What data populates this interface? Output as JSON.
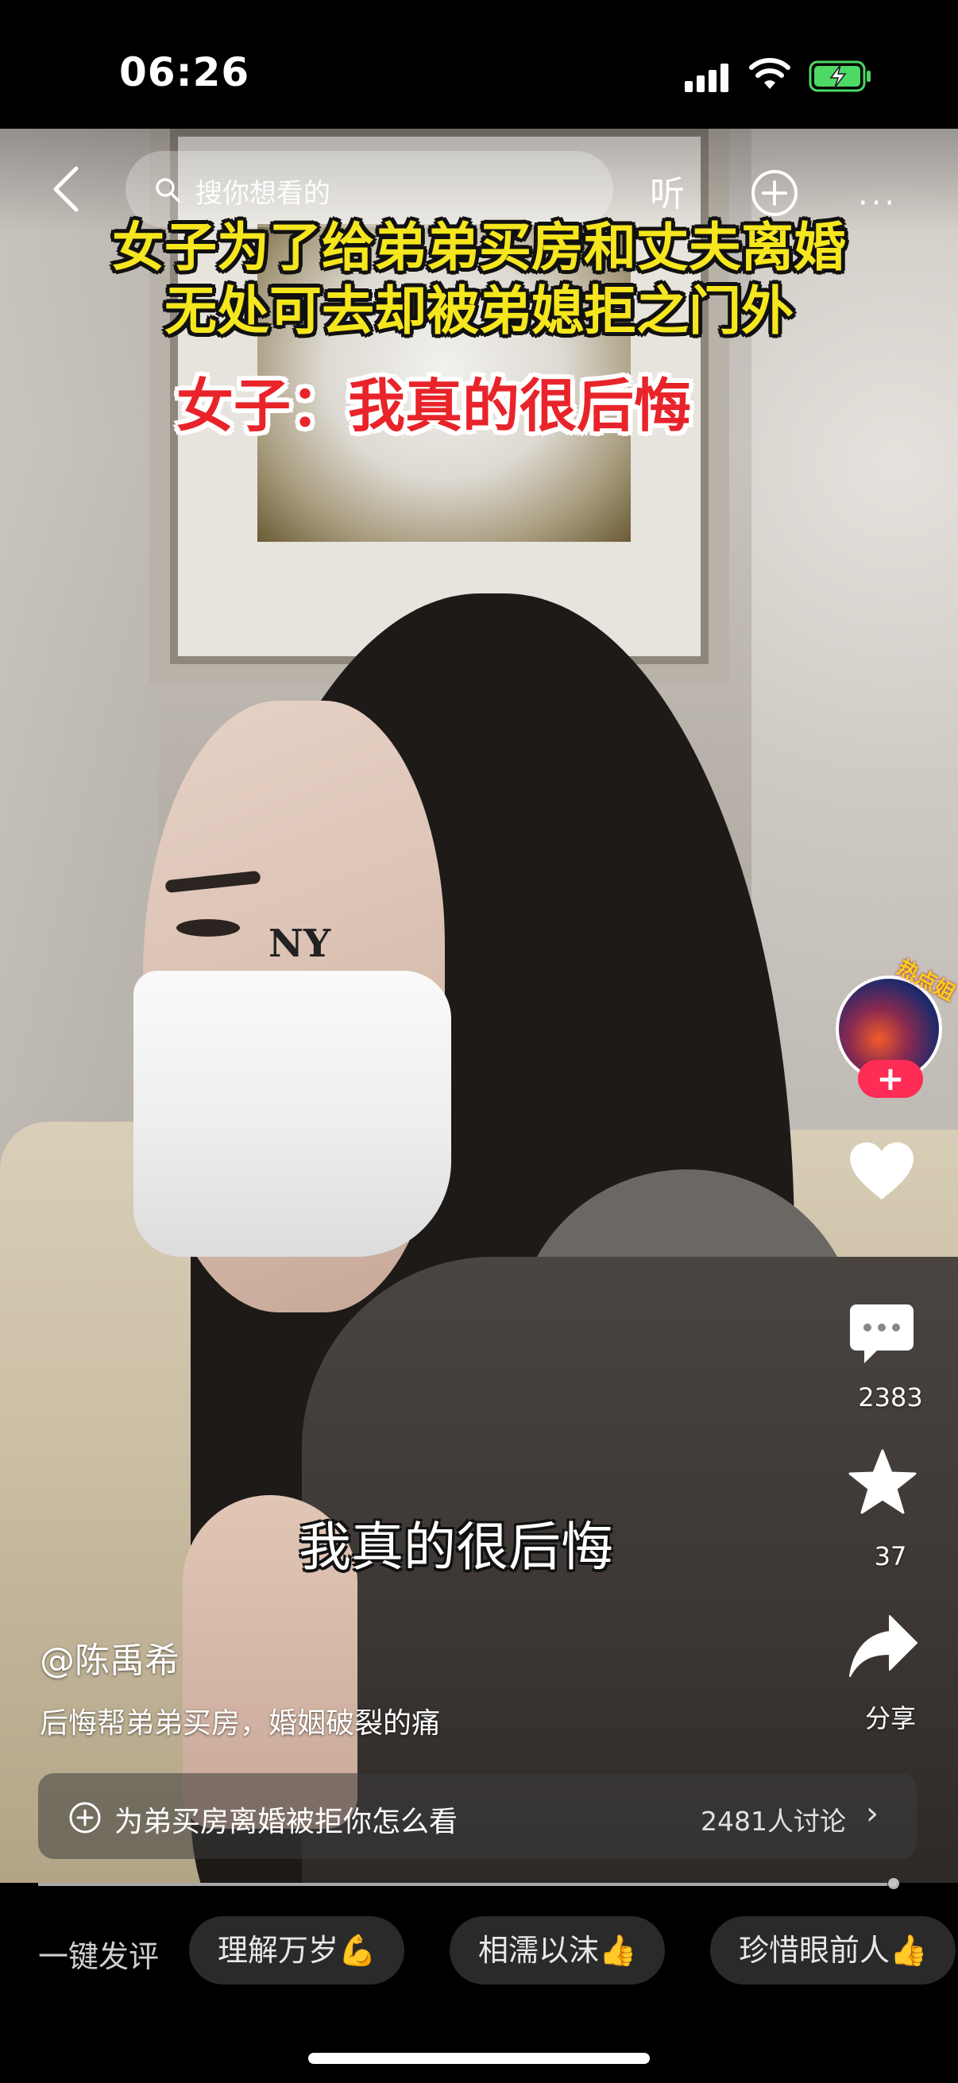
{
  "status_bar": {
    "time": "06:26"
  },
  "top_bar": {
    "search_placeholder": "搜你想看的",
    "listen_label": "听"
  },
  "headline": {
    "line1": "女子为了给弟弟买房和丈夫离婚",
    "line2": "无处可去却被弟媳拒之门外",
    "line3": "女子：我真的很后悔"
  },
  "video": {
    "mask_logo": "NY",
    "subtitle": "我真的很后悔",
    "progress": 0.99
  },
  "right_rail": {
    "avatar_tag": "热点姐",
    "follow_symbol": "+",
    "comment_count": "2383",
    "favorite_count": "37",
    "share_label": "分享"
  },
  "caption": {
    "author": "@陈禹希",
    "description": "后悔帮弟弟买房，婚姻破裂的痛"
  },
  "topic": {
    "text": "为弟买房离婚被拒你怎么看",
    "count": "2481人讨论",
    "chevron": "›"
  },
  "quick_comment": {
    "label": "一键发评",
    "chips": [
      "理解万岁💪",
      "相濡以沫👍",
      "珍惜眼前人👍"
    ]
  },
  "colors": {
    "accent_red": "#ff2c55",
    "headline_yellow": "#f5e61e",
    "headline_red": "#e8242a",
    "battery_green": "#4cd964"
  }
}
